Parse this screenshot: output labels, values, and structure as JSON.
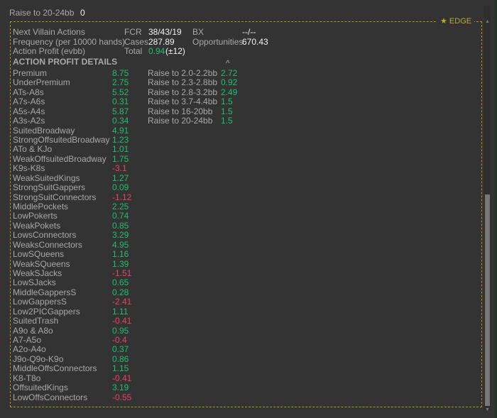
{
  "top_row": {
    "label": "Raise to 20-24bb",
    "value": "0"
  },
  "panel": {
    "badge": "★ EDGE",
    "summary": {
      "col1": [
        "Next Villain Actions",
        "Frequency (per 10000 hands)",
        "Action Profit (evbb)"
      ],
      "fcr_label": "FCR",
      "fcr_value": "38/43/19",
      "bx_label": "BX",
      "bx_value": "--/--",
      "cases_label": "Cases",
      "cases_value": "287.89",
      "opp_label": "Opportunities",
      "opp_value": "670.43",
      "total_label": "Total",
      "total_value": "0.94",
      "total_err": "(±12)"
    },
    "details_title": "ACTION PROFIT DETAILS",
    "collapse_icon": "^",
    "hands": [
      {
        "label": "Premium",
        "value": "8.75"
      },
      {
        "label": "UnderPremium",
        "value": "2.75"
      },
      {
        "label": "ATs-A8s",
        "value": "5.52"
      },
      {
        "label": "A7s-A6s",
        "value": "0.31"
      },
      {
        "label": "A5s-A4s",
        "value": "5.87"
      },
      {
        "label": "A3s-A2s",
        "value": "0.34"
      },
      {
        "label": "SuitedBroadway",
        "value": "4.91"
      },
      {
        "label": "StrongOffsuitedBroadway",
        "value": "1.23"
      },
      {
        "label": "ATo & KJo",
        "value": "1.01"
      },
      {
        "label": "WeakOffsuitedBroadway",
        "value": "1.75"
      },
      {
        "label": "K9s-K8s",
        "value": "-3.1"
      },
      {
        "label": "WeakSuitedKings",
        "value": "1.27"
      },
      {
        "label": "StrongSuitGappers",
        "value": "0.09"
      },
      {
        "label": "StrongSuitConnectors",
        "value": "-1.12"
      },
      {
        "label": "MiddlePockets",
        "value": "2.25"
      },
      {
        "label": "LowPokerts",
        "value": "0.74"
      },
      {
        "label": "WeakPokets",
        "value": "0.85"
      },
      {
        "label": "LowsConnectors",
        "value": "3.29"
      },
      {
        "label": "WeaksConnectors",
        "value": "4.95"
      },
      {
        "label": "LowSQueens",
        "value": "1.16"
      },
      {
        "label": "WeakSQueens",
        "value": "1.39"
      },
      {
        "label": "WeakSJacks",
        "value": "-1.51"
      },
      {
        "label": "LowSJacks",
        "value": "0.65"
      },
      {
        "label": "MiddleGappersS",
        "value": "0.28"
      },
      {
        "label": "LowGappersS",
        "value": "-2.41"
      },
      {
        "label": "Low2PICGappers",
        "value": "1.11"
      },
      {
        "label": "SuitedTrash",
        "value": "-0.41"
      },
      {
        "label": "A9o & A8o",
        "value": "0.95"
      },
      {
        "label": "A7-A5o",
        "value": "-0.4"
      },
      {
        "label": "A2o-A4o",
        "value": "0.37"
      },
      {
        "label": "J9o-Q9o-K9o",
        "value": "0.86"
      },
      {
        "label": "MiddleOffsConnectors",
        "value": "1.15"
      },
      {
        "label": "K8-T8o",
        "value": "-0.41"
      },
      {
        "label": "OffsuitedKings",
        "value": "3.19"
      },
      {
        "label": "LowOffsConnectors",
        "value": "-0.55"
      }
    ],
    "raises": [
      {
        "label": "Raise to 2.0-2.2bb",
        "value": "2.72"
      },
      {
        "label": "Raise to 2.3-2.8bb",
        "value": "0.92"
      },
      {
        "label": "Raise to 2.8-3.2bb",
        "value": "2.49"
      },
      {
        "label": "Raise to 3.7-4.4bb",
        "value": "1.5"
      },
      {
        "label": "Raise to 16-20bb",
        "value": "1.5"
      },
      {
        "label": "Raise to 20-24bb",
        "value": "1.5"
      }
    ]
  }
}
